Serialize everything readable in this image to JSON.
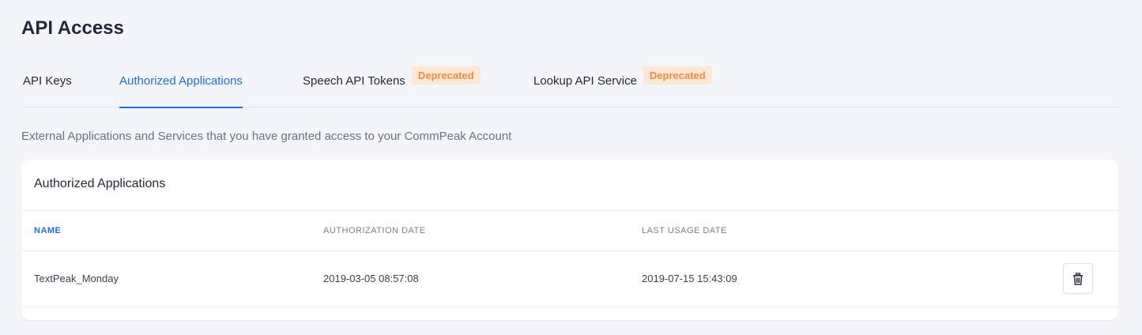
{
  "page": {
    "title": "API Access"
  },
  "tabs": [
    {
      "label": "API Keys",
      "active": false
    },
    {
      "label": "Authorized Applications",
      "active": true
    },
    {
      "label": "Speech API Tokens",
      "active": false,
      "badge": "Deprecated"
    },
    {
      "label": "Lookup API Service",
      "active": false,
      "badge": "Deprecated"
    }
  ],
  "description": "External Applications and Services that you have granted access to your CommPeak Account",
  "card": {
    "title": "Authorized Applications",
    "columns": [
      "NAME",
      "AUTHORIZATION DATE",
      "LAST USAGE DATE"
    ],
    "rows": [
      {
        "name": "TextPeak_Monday",
        "authorization_date": "2019-03-05 08:57:08",
        "last_usage_date": "2019-07-15 15:43:09",
        "action_icon": "trash-icon"
      }
    ]
  },
  "colors": {
    "accent": "#1f6fe5",
    "badge_bg": "#fde7d6",
    "badge_text": "#f08c3a",
    "page_bg": "#f4f5f9"
  }
}
